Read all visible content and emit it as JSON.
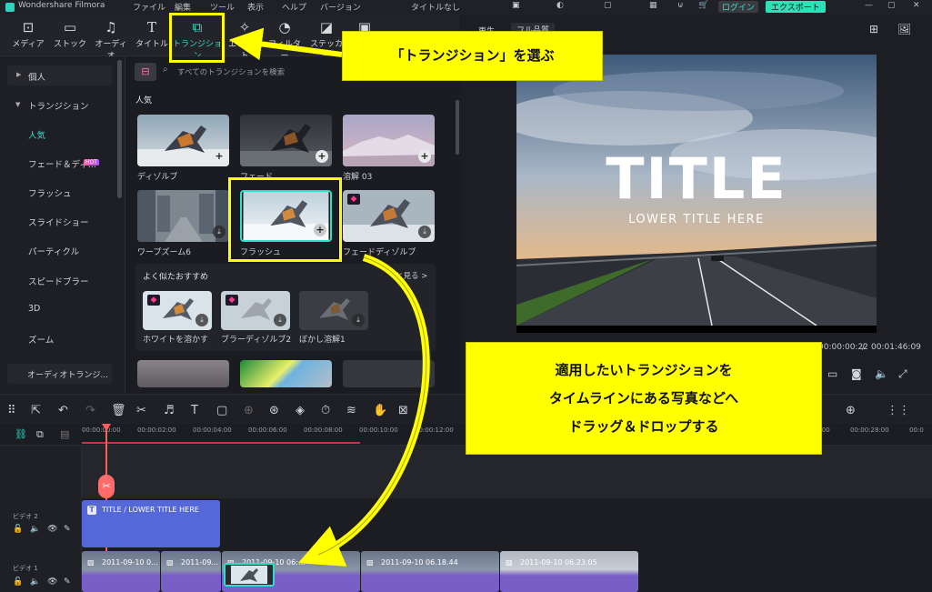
{
  "titlebar": {
    "app": "Wondershare Filmora",
    "menu": [
      "ファイル",
      "編集",
      "ツール",
      "表示",
      "ヘルプ",
      "バージョン"
    ],
    "doc_title": "タイトルなし",
    "login": "ログイン",
    "export": "エクスポート"
  },
  "toolbar": {
    "items": [
      {
        "label": "メディア"
      },
      {
        "label": "ストック"
      },
      {
        "label": "オーディオ"
      },
      {
        "label": "タイトル"
      },
      {
        "label": "トランジション"
      },
      {
        "label": "エフェクト"
      },
      {
        "label": "フィルター"
      },
      {
        "label": "ステッカー"
      }
    ]
  },
  "sidebar": {
    "items": [
      {
        "label": "個人"
      },
      {
        "label": "トランジション"
      },
      {
        "label": "人気"
      },
      {
        "label": "フェード＆ディ..."
      },
      {
        "label": "フラッシュ"
      },
      {
        "label": "スライドショー"
      },
      {
        "label": "パーティクル"
      },
      {
        "label": "スピードブラー"
      },
      {
        "label": "3D"
      },
      {
        "label": "ズーム"
      },
      {
        "label": "オーディオトランジ..."
      }
    ],
    "hot_badge": "HOT"
  },
  "search": {
    "placeholder": "すべてのトランジションを検索"
  },
  "section": {
    "popular": "人気",
    "similar": "よく似たおすすめ",
    "see_more": "と見る >"
  },
  "transitions": [
    {
      "label": "ディゾルブ"
    },
    {
      "label": "フェード"
    },
    {
      "label": "溶解 03"
    },
    {
      "label": "ワープズーム6"
    },
    {
      "label": "フラッシュ"
    },
    {
      "label": "フェードディゾルブ"
    }
  ],
  "similar_items": [
    {
      "label": "ホワイトを溶かす"
    },
    {
      "label": "ブラーディゾルブ2"
    },
    {
      "label": "ぼかし溶解1"
    }
  ],
  "preview": {
    "tab1": "再生",
    "tab2": "フル品質",
    "title": "TITLE",
    "subtitle": "LOWER TITLE HERE",
    "current_time": "00:00:00:22",
    "total_time": "00:01:46:09",
    "separator": "/"
  },
  "ruler": {
    "ticks": [
      "00:00:00:00",
      "00:00:02:00",
      "00:00:04:00",
      "00:00:06:00",
      "00:00:08:00",
      "00:00:10:00",
      "00:00:12:00",
      "00:00:26:00",
      "00:00:28:00",
      "00:0"
    ]
  },
  "tracks": {
    "video2": "ビデオ 2",
    "video1": "ビデオ 1",
    "title_clip": "TITLE / LOWER TITLE HERE",
    "clips": [
      "2011-09-10 0...",
      "2011-09...",
      "2011-09-10 06:...",
      "2011-09-10 06.18.44",
      "2011-09-10 06.23.05"
    ]
  },
  "callouts": {
    "select": "「トランジション」を選ぶ",
    "line1": "適用したいトランジションを",
    "line2": "タイムラインにある写真などへ",
    "line3": "ドラッグ＆ドロップする"
  }
}
